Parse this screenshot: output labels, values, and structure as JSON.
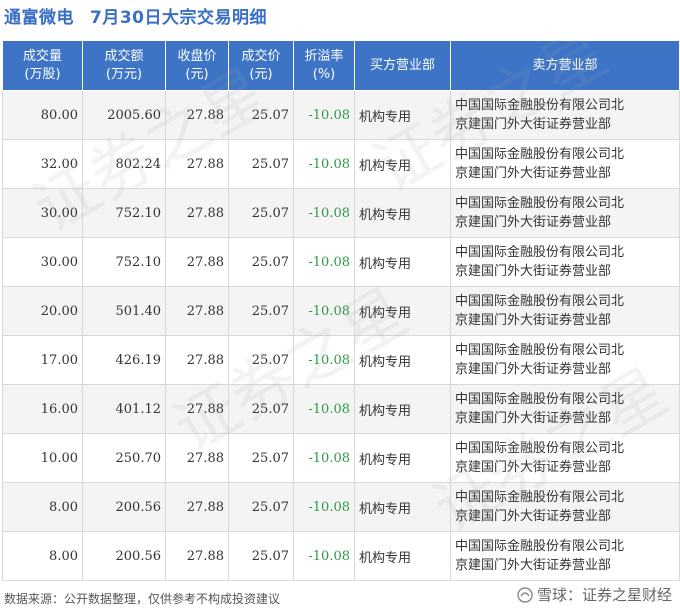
{
  "title": {
    "stock": "通富微电",
    "heading": "7月30日大宗交易明细"
  },
  "table": {
    "headers": [
      {
        "line1": "成交量",
        "line2": "(万股)"
      },
      {
        "line1": "成交额",
        "line2": "(万元)"
      },
      {
        "line1": "收盘价",
        "line2": "(元)"
      },
      {
        "line1": "成交价",
        "line2": "(元)"
      },
      {
        "line1": "折溢率",
        "line2": "(%)"
      },
      {
        "line1": "买方营业部",
        "line2": ""
      },
      {
        "line1": "卖方营业部",
        "line2": ""
      }
    ],
    "rows": [
      {
        "volume": "80.00",
        "amount": "2005.60",
        "close": "27.88",
        "price": "25.07",
        "premium": "-10.08",
        "buyer": "机构专用",
        "seller1": "中国国际金融股份有限公司北",
        "seller2": "京建国门外大街证券营业部"
      },
      {
        "volume": "32.00",
        "amount": "802.24",
        "close": "27.88",
        "price": "25.07",
        "premium": "-10.08",
        "buyer": "机构专用",
        "seller1": "中国国际金融股份有限公司北",
        "seller2": "京建国门外大街证券营业部"
      },
      {
        "volume": "30.00",
        "amount": "752.10",
        "close": "27.88",
        "price": "25.07",
        "premium": "-10.08",
        "buyer": "机构专用",
        "seller1": "中国国际金融股份有限公司北",
        "seller2": "京建国门外大街证券营业部"
      },
      {
        "volume": "30.00",
        "amount": "752.10",
        "close": "27.88",
        "price": "25.07",
        "premium": "-10.08",
        "buyer": "机构专用",
        "seller1": "中国国际金融股份有限公司北",
        "seller2": "京建国门外大街证券营业部"
      },
      {
        "volume": "20.00",
        "amount": "501.40",
        "close": "27.88",
        "price": "25.07",
        "premium": "-10.08",
        "buyer": "机构专用",
        "seller1": "中国国际金融股份有限公司北",
        "seller2": "京建国门外大街证券营业部"
      },
      {
        "volume": "17.00",
        "amount": "426.19",
        "close": "27.88",
        "price": "25.07",
        "premium": "-10.08",
        "buyer": "机构专用",
        "seller1": "中国国际金融股份有限公司北",
        "seller2": "京建国门外大街证券营业部"
      },
      {
        "volume": "16.00",
        "amount": "401.12",
        "close": "27.88",
        "price": "25.07",
        "premium": "-10.08",
        "buyer": "机构专用",
        "seller1": "中国国际金融股份有限公司北",
        "seller2": "京建国门外大街证券营业部"
      },
      {
        "volume": "10.00",
        "amount": "250.70",
        "close": "27.88",
        "price": "25.07",
        "premium": "-10.08",
        "buyer": "机构专用",
        "seller1": "中国国际金融股份有限公司北",
        "seller2": "京建国门外大街证券营业部"
      },
      {
        "volume": "8.00",
        "amount": "200.56",
        "close": "27.88",
        "price": "25.07",
        "premium": "-10.08",
        "buyer": "机构专用",
        "seller1": "中国国际金融股份有限公司北",
        "seller2": "京建国门外大街证券营业部"
      },
      {
        "volume": "8.00",
        "amount": "200.56",
        "close": "27.88",
        "price": "25.07",
        "premium": "-10.08",
        "buyer": "机构专用",
        "seller1": "中国国际金融股份有限公司北",
        "seller2": "京建国门外大街证券营业部"
      }
    ]
  },
  "footer": {
    "source": "数据来源：公开数据整理，仅供参考不构成投资建议",
    "brand": "雪球：证券之星财经"
  },
  "watermark": "证券之星",
  "colors": {
    "header_bg": "#3d74c6",
    "title": "#3a6fc4",
    "negative": "#2e9a47"
  }
}
